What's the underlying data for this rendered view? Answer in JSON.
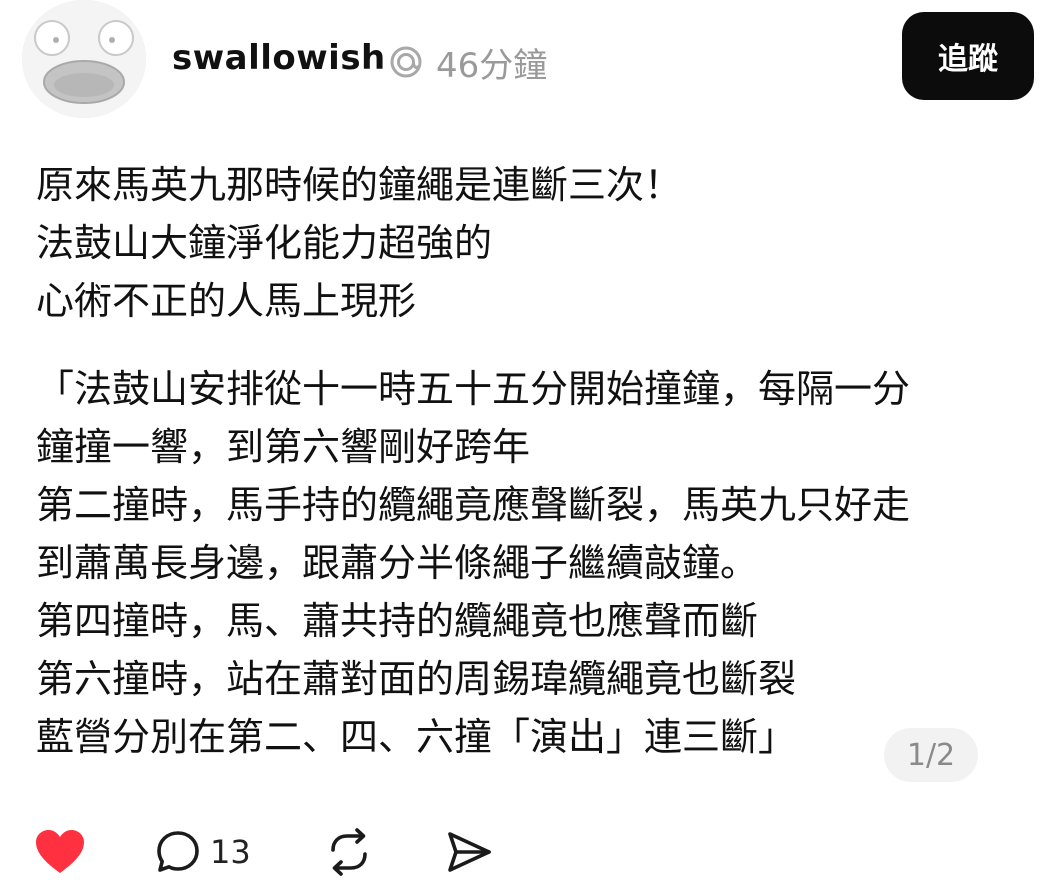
{
  "post": {
    "author": "swallowish",
    "time": "46分鐘",
    "follow_label": "追蹤",
    "paragraphs": [
      [
        "原來馬英九那時候的鐘繩是連斷三次！",
        "法鼓山大鐘淨化能力超強的",
        "心術不正的人馬上現形"
      ],
      [
        "「法鼓山安排從十一時五十五分開始撞鐘，每隔一分",
        "鐘撞一響，到第六響剛好跨年",
        "第二撞時，馬手持的纜繩竟應聲斷裂，馬英九只好走",
        "到蕭萬長身邊，跟蕭分半條繩子繼續敲鐘。",
        "第四撞時，馬、蕭共持的纜繩竟也應聲而斷",
        "第六撞時，站在蕭對面的周錫瑋纜繩竟也斷裂",
        "藍營分別在第二、四、六撞「演出」連三斷」"
      ]
    ],
    "page_indicator": "1/2"
  },
  "actions": {
    "like_icon": "heart-filled",
    "like_color": "#ff3040",
    "comment_icon": "speech-bubble",
    "comment_count": "13",
    "repost_icon": "repost-arrows",
    "share_icon": "paper-plane"
  }
}
